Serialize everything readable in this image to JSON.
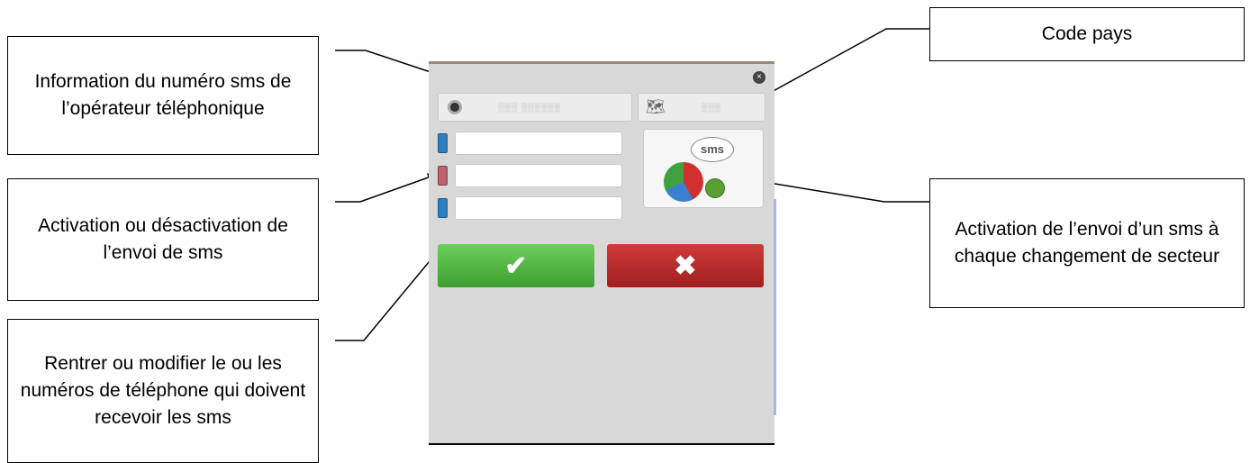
{
  "callouts": {
    "operator_sms": "Information du numéro sms de l’opérateur téléphonique",
    "activation": "Activation ou désactivation de l’envoi de sms",
    "numbers": "Rentrer ou modifier le ou les numéros de téléphone qui doivent recevoir les sms",
    "country_code": "Code pays",
    "sector_sms": "Activation de l’envoi d’un sms à chaque changement de secteur"
  },
  "phone_ui": {
    "sms_number": "░░░  ░░░░░░",
    "country_code": "░░░",
    "sms_label": "sms",
    "ok_symbol": "✔",
    "cancel_symbol": "✖",
    "close_symbol": "×",
    "world_icon": "world-map-icon",
    "numbers": [
      {
        "value": "",
        "active": true
      },
      {
        "value": "",
        "active": false
      },
      {
        "value": "",
        "active": true
      }
    ]
  },
  "colors": {
    "ok_green": "#4caf3c",
    "cancel_red": "#b82828",
    "panel_gray": "#d8d8d8"
  }
}
